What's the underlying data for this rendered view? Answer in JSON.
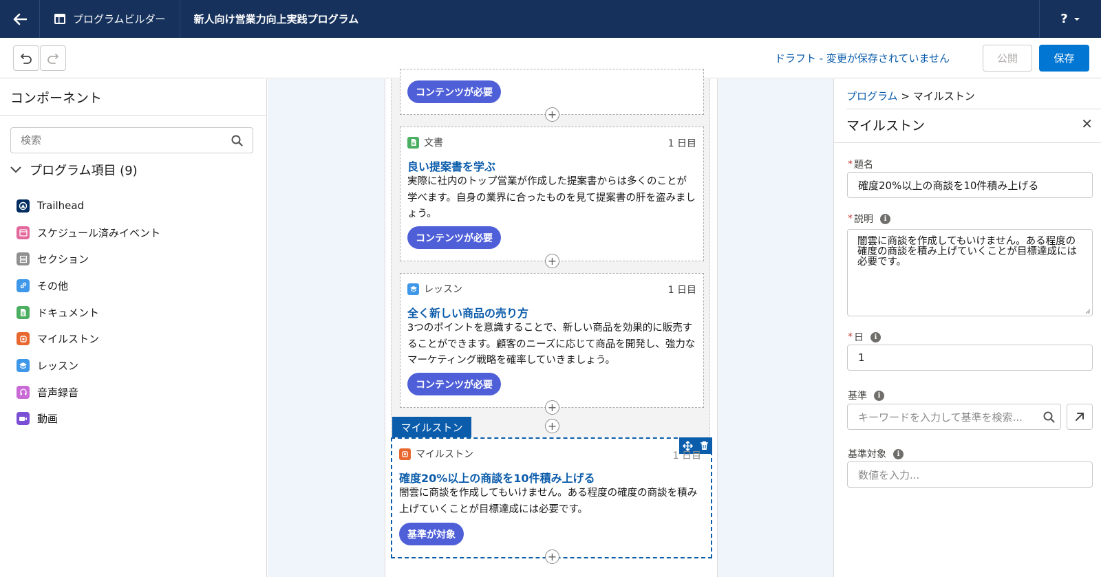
{
  "topbar": {
    "builder_label": "プログラムビルダー",
    "program_title": "新人向け営業力向上実践プログラム",
    "help_label": "?"
  },
  "toolbar": {
    "draft_status": "ドラフト - 変更が保存されていません",
    "publish_label": "公開",
    "save_label": "保存"
  },
  "left_panel": {
    "title": "コンポーネント",
    "search_placeholder": "検索",
    "section_label": "プログラム項目 (9)",
    "items": [
      {
        "label": "Trailhead",
        "color": "#032d60"
      },
      {
        "label": "スケジュール済みイベント",
        "color": "#e3699c"
      },
      {
        "label": "セクション",
        "color": "#8f8f8f"
      },
      {
        "label": "その他",
        "color": "#3e97e8"
      },
      {
        "label": "ドキュメント",
        "color": "#4bae61"
      },
      {
        "label": "マイルストン",
        "color": "#e8672f"
      },
      {
        "label": "レッスン",
        "color": "#3e97e8"
      },
      {
        "label": "音声録音",
        "color": "#c96ad6"
      },
      {
        "label": "動画",
        "color": "#7a4fd6"
      }
    ]
  },
  "canvas": {
    "top_card_pill": "コンテンツが必要",
    "card_document": {
      "type": "文書",
      "day": "1 日目",
      "title": "良い提案書を学ぶ",
      "desc": "実際に社内のトップ営業が作成した提案書からは多くのことが学べます。自身の業界に合ったものを見て提案書の肝を盗みましょう。",
      "pill": "コンテンツが必要"
    },
    "card_lesson": {
      "type": "レッスン",
      "day": "1 日目",
      "title": "全く新しい商品の売り方",
      "desc": "3つのポイントを意識することで、新しい商品を効果的に販売することができます。顧客のニーズに応じて商品を開発し、強力なマーケティング戦略を確率していきましょう。",
      "pill": "コンテンツが必要"
    },
    "milestone_tab": "マイルストン",
    "card_milestone": {
      "type": "マイルストン",
      "day": "1 日目",
      "title": "確度20%以上の商談を10件積み上げる",
      "desc": "闇雲に商談を作成してもいけません。ある程度の確度の商談を積み上げていくことが目標達成には必要です。",
      "pill": "基準が対象"
    },
    "plus_label": "+"
  },
  "right_panel": {
    "breadcrumb_link": "プログラム",
    "breadcrumb_sep": ">",
    "breadcrumb_current": "マイルストン",
    "title": "マイルストン",
    "close_label": "✕",
    "field_title_label": "題名",
    "field_title_value": "確度20%以上の商談を10件積み上げる",
    "field_desc_label": "説明",
    "field_desc_value": "闇雲に商談を作成してもいけません。ある程度の確度の商談を積み上げていくことが目標達成には必要です。",
    "field_day_label": "日",
    "field_day_value": "1",
    "field_criteria_label": "基準",
    "field_criteria_placeholder": "キーワードを入力して基準を検索...",
    "field_target_label": "基準対象",
    "field_target_placeholder": "数値を入力...",
    "required_mark": "*",
    "info_mark": "i"
  },
  "colors": {
    "header_bg": "#16325c",
    "brand_blue": "#0176d3",
    "link_blue": "#0b5cab",
    "pill_bg": "#4f5fd8"
  }
}
